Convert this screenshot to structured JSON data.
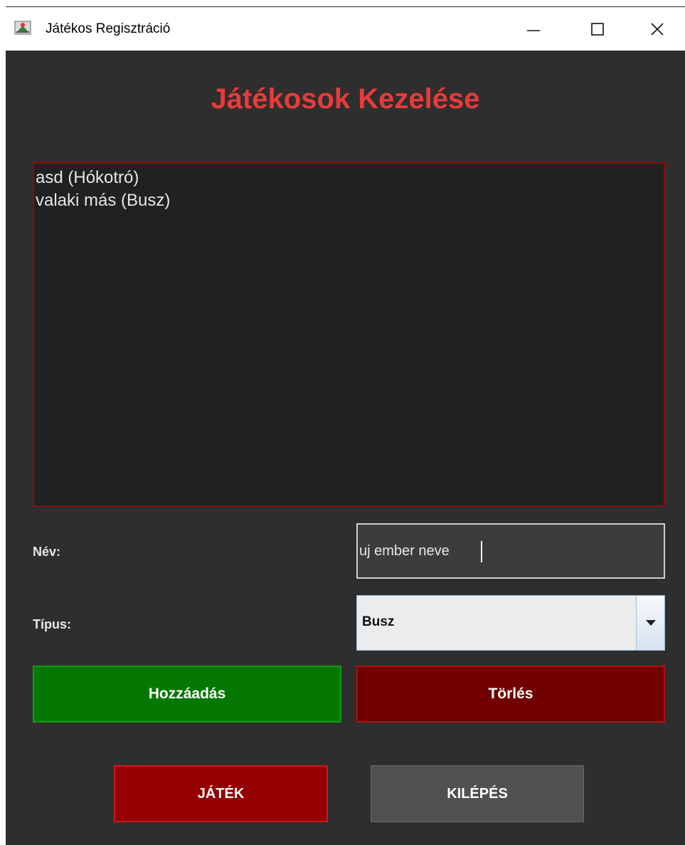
{
  "window": {
    "title": "Játékos Regisztráció",
    "controls": {
      "minimize": "minimize-icon",
      "maximize": "maximize-icon",
      "close": "close-icon"
    }
  },
  "main": {
    "heading": "Játékosok Kezelése",
    "players": [
      "asd (Hókotró)",
      "valaki más (Busz)"
    ],
    "name_label": "Név:",
    "name_value": "uj ember neve",
    "type_label": "Típus:",
    "type_value": "Busz"
  },
  "buttons": {
    "add": "Hozzáadás",
    "delete": "Törlés",
    "play": "JÁTÉK",
    "exit": "KILÉPÉS"
  },
  "colors": {
    "background": "#2e2e2e",
    "heading": "#ea3a3a",
    "add_button": "#057803",
    "delete_button": "#720000",
    "play_button": "#940000",
    "exit_button": "#505050"
  }
}
